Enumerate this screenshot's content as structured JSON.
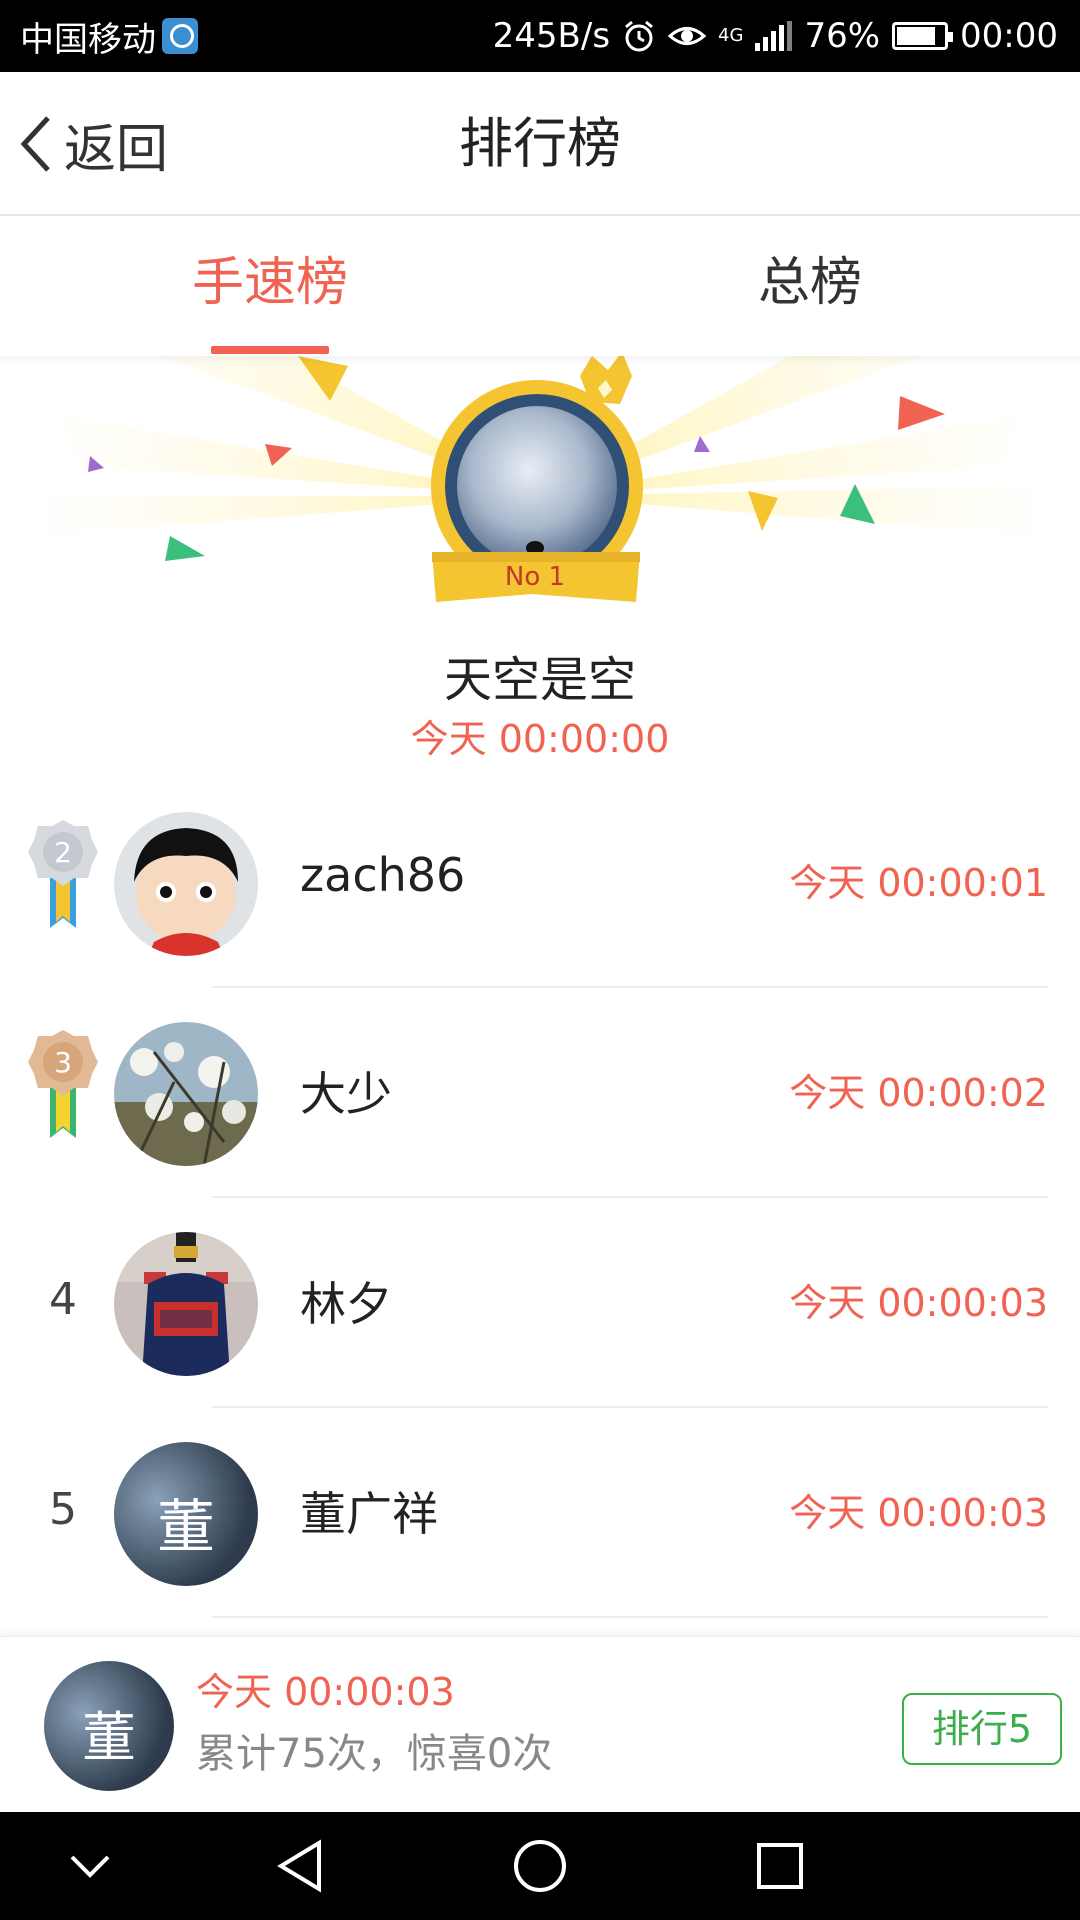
{
  "status_bar": {
    "carrier": "中国移动",
    "net_speed": "245B/s",
    "network_type": "4G",
    "battery": "76%",
    "time": "00:00"
  },
  "header": {
    "back_label": "返回",
    "title": "排行榜"
  },
  "tabs": [
    {
      "label": "手速榜",
      "active": true
    },
    {
      "label": "总榜",
      "active": false
    }
  ],
  "champion": {
    "badge": "No 1",
    "name": "天空是空",
    "time": "今天 00:00:00"
  },
  "ranking": [
    {
      "rank": "2",
      "name": "zach86",
      "time": "今天 00:00:01",
      "medal": "silver"
    },
    {
      "rank": "3",
      "name": "大少",
      "time": "今天 00:00:02",
      "medal": "bronze"
    },
    {
      "rank": "4",
      "name": "林夕",
      "time": "今天 00:00:03"
    },
    {
      "rank": "5",
      "name": "董广祥",
      "time": "今天 00:00:03",
      "avatar_char": "董"
    }
  ],
  "my_rank": {
    "avatar_char": "董",
    "time": "今天 00:00:03",
    "stats": "累计75次，惊喜0次",
    "rank_button": "排行5"
  },
  "colors": {
    "accent": "#f06352",
    "green": "#3cae4c",
    "gold": "#f5c431"
  }
}
